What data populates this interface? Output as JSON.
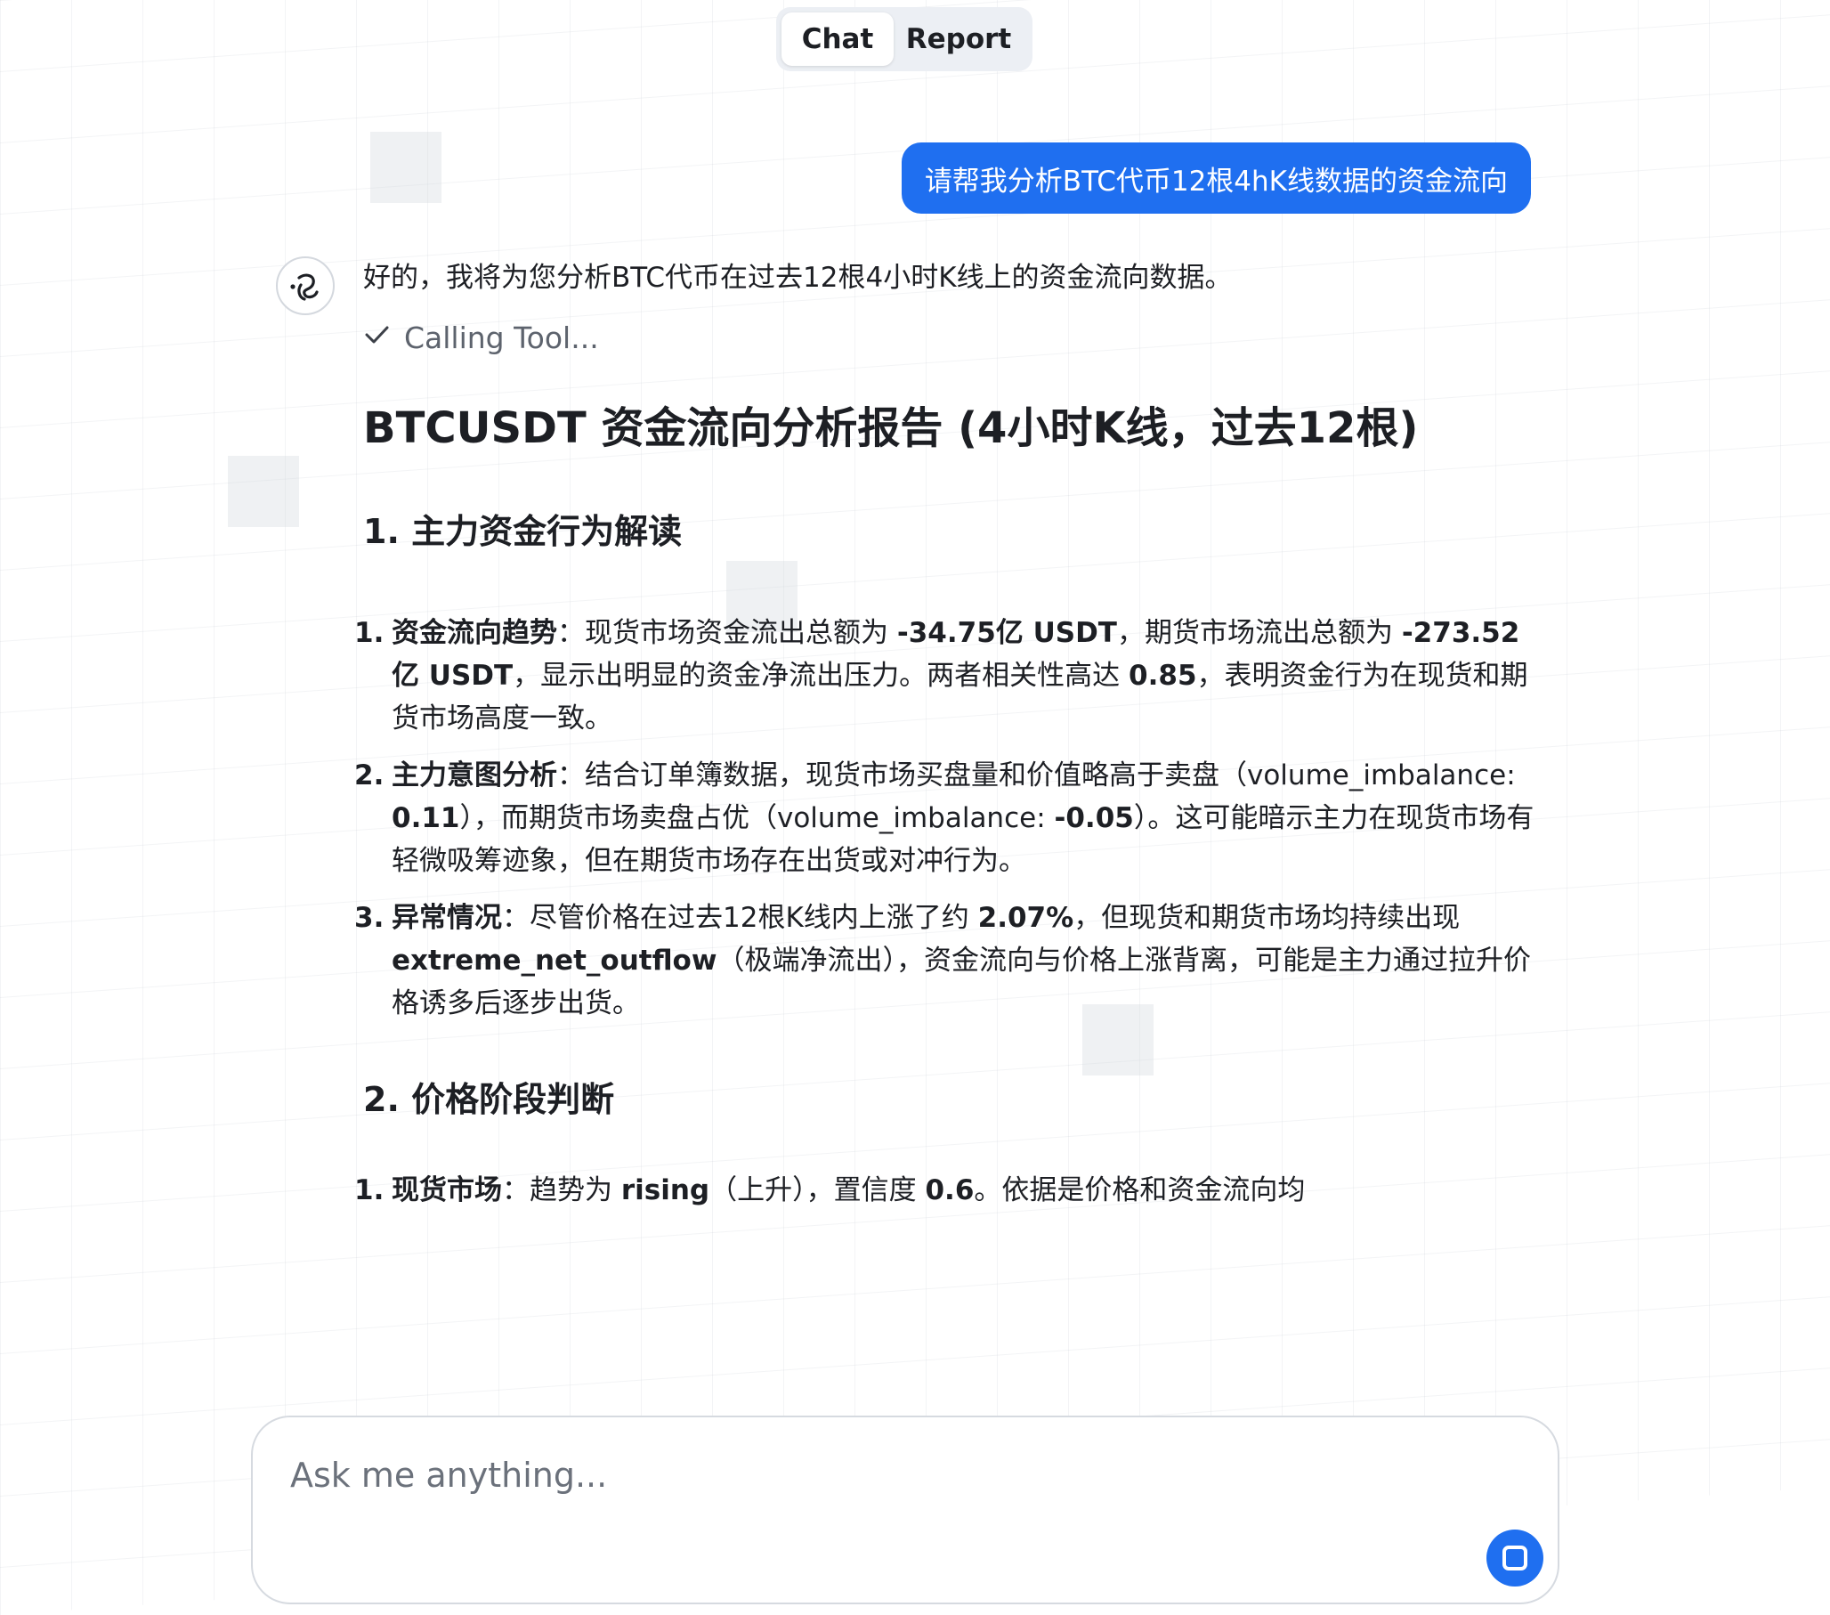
{
  "tabs": {
    "chat": "Chat",
    "report": "Report",
    "active": "Chat"
  },
  "user_message": "请帮我分析BTC代币12根4hK线数据的资金流向",
  "assistant": {
    "intro": "好的，我将为您分析BTC代币在过去12根4小时K线上的资金流向数据。",
    "tool_status": "Calling Tool...",
    "report_title": "BTCUSDT 资金流向分析报告 (4小时K线，过去12根)",
    "section1": {
      "heading": "1. 主力资金行为解读",
      "items": [
        {
          "num": "1.",
          "label": "资金流向趋势",
          "t1": "：现货市场资金流出总额为 ",
          "v1": "-34.75亿 USDT",
          "t2": "，期货市场流出总额为 ",
          "v2": "-273.52亿 USDT",
          "t3": "，显示出明显的资金净流出压力。两者相关性高达 ",
          "v3": "0.85",
          "t4": "，表明资金行为在现货和期货市场高度一致。"
        },
        {
          "num": "2.",
          "label": "主力意图分析",
          "t1": "：结合订单簿数据，现货市场买盘量和价值略高于卖盘（volume_imbalance: ",
          "v1": "0.11",
          "t2": "），而期货市场卖盘占优（volume_imbalance: ",
          "v2": "-0.05",
          "t3": "）。这可能暗示主力在现货市场有轻微吸筹迹象，但在期货市场存在出货或对冲行为。"
        },
        {
          "num": "3.",
          "label": "异常情况",
          "t1": "：尽管价格在过去12根K线内上涨了约 ",
          "v1": "2.07%",
          "t2": "，但现货和期货市场均持续出现 ",
          "v2": "extreme_net_outflow",
          "t3": "（极端净流出），资金流向与价格上涨背离，可能是主力通过拉升价格诱多后逐步出货。"
        }
      ]
    },
    "section2": {
      "heading": "2. 价格阶段判断",
      "items": [
        {
          "num": "1.",
          "label": "现货市场",
          "t1": "：趋势为 ",
          "v1": "rising",
          "t2": "（上升），置信度 ",
          "v2": "0.6",
          "t3": "。依据是价格和资金流向均"
        }
      ]
    }
  },
  "composer": {
    "placeholder": "Ask me anything...",
    "value": ""
  },
  "colors": {
    "accent": "#1f6ff0",
    "text": "#1d1f24",
    "muted": "#5d636d",
    "border": "#d6dae0"
  },
  "icons": {
    "avatar": "assistant-logo-icon",
    "tool_status": "checkmark-icon",
    "send_button": "stop-square-icon"
  }
}
